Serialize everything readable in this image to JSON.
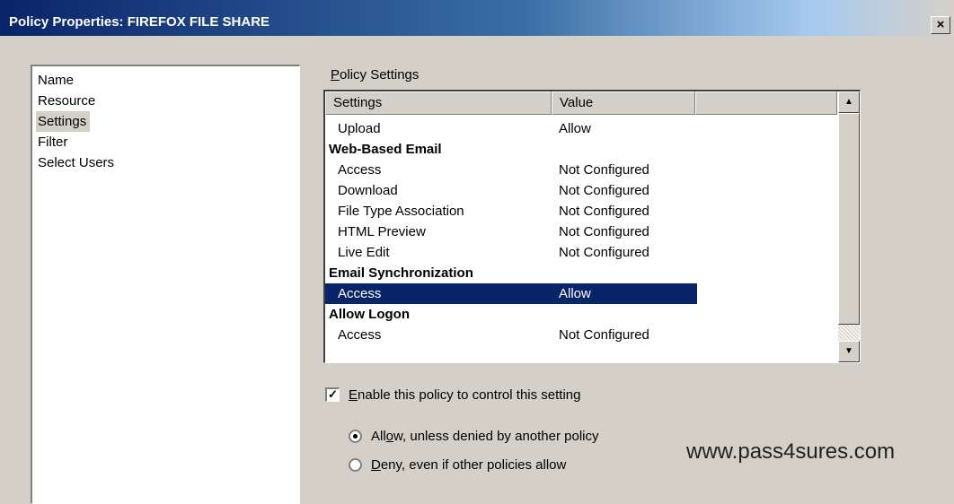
{
  "window": {
    "title": "Policy Properties: FIREFOX FILE SHARE",
    "close_label": "×"
  },
  "nav": {
    "items": [
      {
        "label": "Name",
        "selected": false
      },
      {
        "label": "Resource",
        "selected": false
      },
      {
        "label": "Settings",
        "selected": true
      },
      {
        "label": "Filter",
        "selected": false
      },
      {
        "label": "Select Users",
        "selected": false
      }
    ]
  },
  "policy_settings": {
    "group_label": "Policy Settings",
    "headers": {
      "settings": "Settings",
      "value": "Value"
    },
    "rows": [
      {
        "setting": "Upload",
        "value": "Allow"
      },
      {
        "setting": "Web-Based Email",
        "value": ""
      },
      {
        "setting": "Access",
        "value": "Not Configured"
      },
      {
        "setting": "Download",
        "value": "Not Configured"
      },
      {
        "setting": "File Type Association",
        "value": "Not Configured"
      },
      {
        "setting": "HTML Preview",
        "value": "Not Configured"
      },
      {
        "setting": "Live Edit",
        "value": "Not Configured"
      },
      {
        "setting": "Email Synchronization",
        "value": ""
      },
      {
        "setting": "Access",
        "value": "Allow"
      },
      {
        "setting": "Allow Logon",
        "value": ""
      },
      {
        "setting": "Access",
        "value": "Not Configured"
      }
    ],
    "scroll_up_icon": "▲",
    "scroll_down_icon": "▼"
  },
  "enable_policy": {
    "label_mnemonic": "E",
    "label_rest": "nable this policy to control this setting",
    "checked": true,
    "check_mark": "✓"
  },
  "radios": {
    "allow": {
      "label_pre": "All",
      "label_mnemonic": "o",
      "label_rest": "w, unless denied by another policy",
      "selected": true
    },
    "deny": {
      "label_pre": "",
      "label_mnemonic": "D",
      "label_rest": "eny, even if other policies allow",
      "selected": false
    }
  },
  "watermark": "www.pass4sures.com"
}
